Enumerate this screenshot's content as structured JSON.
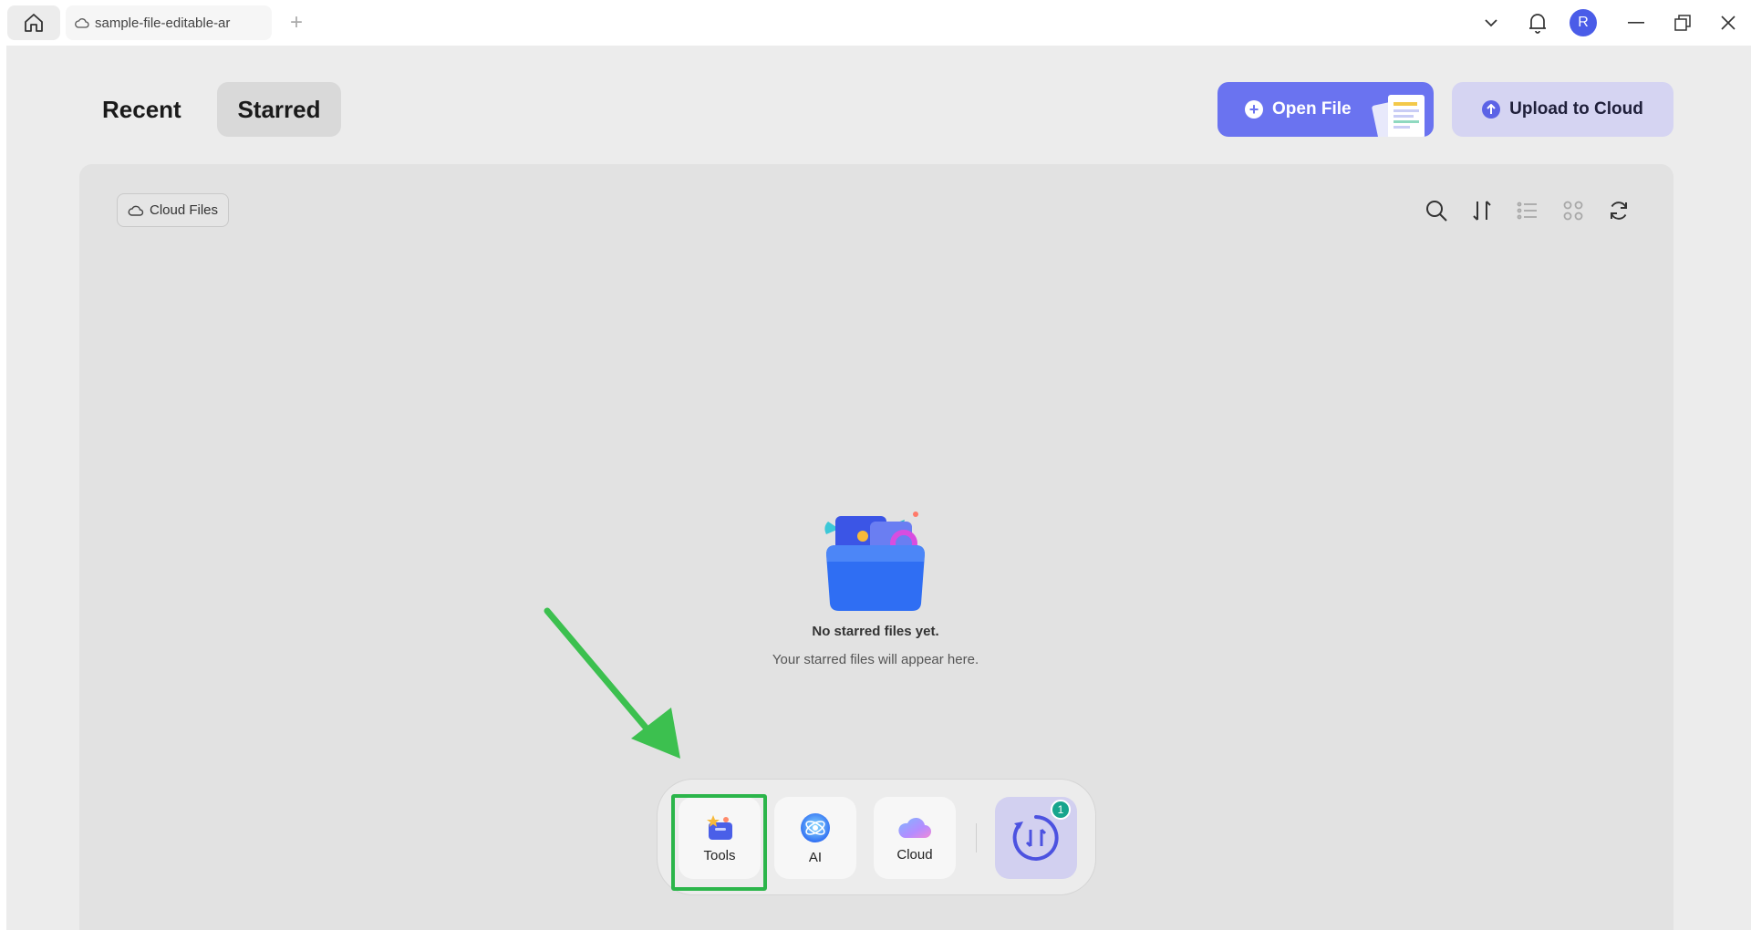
{
  "titlebar": {
    "tab_title": "sample-file-editable-ar",
    "new_tab_symbol": "+",
    "avatar_initial": "R"
  },
  "header": {
    "tabs": [
      {
        "label": "Recent",
        "active": false
      },
      {
        "label": "Starred",
        "active": true
      }
    ],
    "open_file_label": "Open File",
    "upload_label": "Upload to Cloud"
  },
  "panel": {
    "cloud_files_label": "Cloud Files",
    "toolbar_icons": [
      "search-icon",
      "sort-icon",
      "list-view-icon",
      "grid-view-icon",
      "refresh-icon"
    ],
    "empty_title": "No starred files yet.",
    "empty_subtitle": "Your starred files will appear here."
  },
  "dock": {
    "items": [
      {
        "label": "Tools",
        "icon": "tools-icon",
        "highlighted": true
      },
      {
        "label": "AI",
        "icon": "ai-icon"
      },
      {
        "label": "Cloud",
        "icon": "cloud-icon"
      }
    ],
    "convert_badge": "1"
  },
  "colors": {
    "accent": "#6a73f0",
    "upload_bg": "#d5d4f2",
    "highlight": "#2bb54a",
    "badge": "#17a58d",
    "avatar": "#4a5ce8"
  }
}
